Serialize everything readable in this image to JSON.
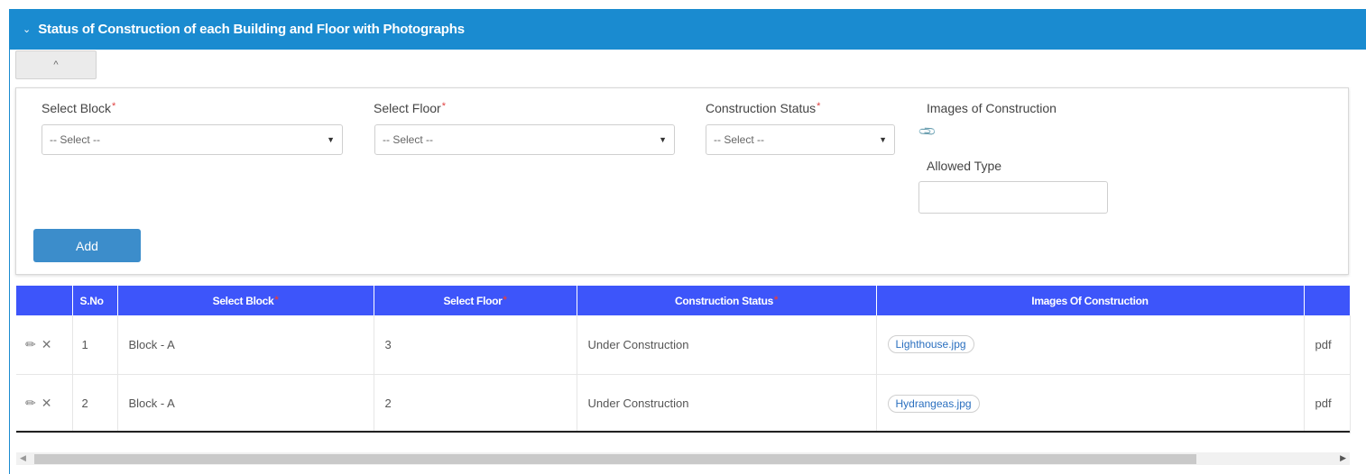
{
  "panel": {
    "title": "Status of Construction of each Building and Floor with Photographs",
    "header_color": "#1a8bd0",
    "chevron_icon": "chevron-down-icon"
  },
  "collapse_button": {
    "icon": "chevron-up-icon",
    "glyph": "^"
  },
  "form": {
    "block": {
      "label": "Select Block",
      "required": "*",
      "value": "-- Select --"
    },
    "floor": {
      "label": "Select Floor",
      "required": "*",
      "value": "-- Select --"
    },
    "status": {
      "label": "Construction Status",
      "required": "*",
      "value": "-- Select --"
    },
    "images": {
      "label": "Images of Construction",
      "icon": "paperclip-icon"
    },
    "allowed_type": {
      "label": "Allowed Type",
      "value": ""
    },
    "add_label": "Add",
    "add_color": "#3c8dcb"
  },
  "table": {
    "header_color": "#3d55fa",
    "columns": [
      "",
      "S.No",
      "Select Block",
      "Select Floor",
      "Construction Status",
      "Images Of Construction",
      ""
    ],
    "required_marker": "*",
    "rows": [
      {
        "sno": "1",
        "block": "Block - A",
        "floor": "3",
        "status": "Under Construction",
        "image": "Lighthouse.jpg",
        "type": "pdf"
      },
      {
        "sno": "2",
        "block": "Block - A",
        "floor": "2",
        "status": "Under Construction",
        "image": "Hydrangeas.jpg",
        "type": "pdf"
      }
    ]
  }
}
